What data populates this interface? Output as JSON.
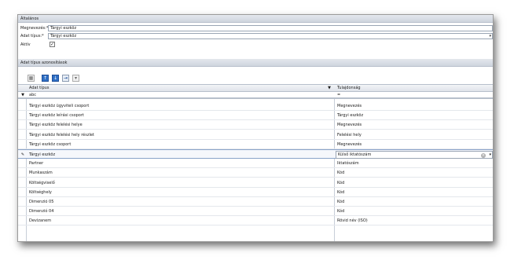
{
  "general": {
    "header": "Általános",
    "name_label": "Megnevezés:*",
    "name_value": "Tárgyi eszköz",
    "type_label": "Adat típus:*",
    "type_value": "Tárgyi eszköz",
    "active_label": "Aktív",
    "active_checked": true
  },
  "identifiers": {
    "header": "Adat típus azonosítások"
  },
  "toolbar": {
    "icons": [
      "grid-settings-icon",
      "move-up-icon",
      "move-down-icon",
      "export-icon",
      "dropdown-icon"
    ]
  },
  "grid": {
    "columns": [
      "Adat típus",
      "Tulajdonság"
    ],
    "filter": {
      "indicator": "▼",
      "col1": "abc",
      "col2": "="
    },
    "rows": [
      {
        "type": "Tárgyi eszköz ügyviteli csoport",
        "property": "Megnevezés"
      },
      {
        "type": "Tárgyi eszköz leírási csoport",
        "property": "Tárgyi eszköz"
      },
      {
        "type": "Tárgyi eszköz felelési helye",
        "property": "Megnevezés"
      },
      {
        "type": "Tárgyi eszköz felelési hely részlet",
        "property": "Felelési hely"
      },
      {
        "type": "Tárgyi eszköz csoport",
        "property": "Megnevezés"
      },
      {
        "type": "Tárgyi eszköz",
        "property": "Külső iktatószám",
        "selected": true,
        "indicator": "✎"
      },
      {
        "type": "Partner",
        "property": "Iktatószám"
      },
      {
        "type": "Munkaszám",
        "property": "Kód"
      },
      {
        "type": "Költségviselő",
        "property": "Kód"
      },
      {
        "type": "Költséghely",
        "property": "Kód"
      },
      {
        "type": "Dimenzió 05",
        "property": "Kód"
      },
      {
        "type": "Dimenzió 04",
        "property": "Kód"
      },
      {
        "type": "Devizanem",
        "property": "Rövid név (ISO)"
      }
    ]
  }
}
